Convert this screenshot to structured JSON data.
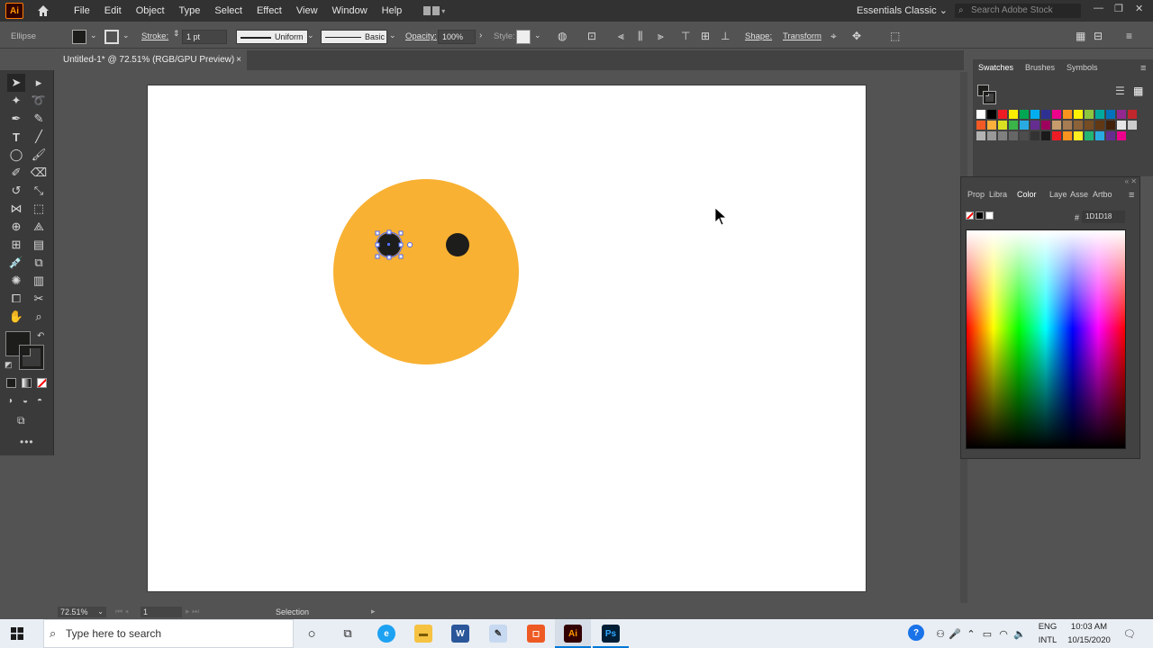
{
  "app": {
    "logo": "Ai",
    "menu": [
      "File",
      "Edit",
      "Object",
      "Type",
      "Select",
      "Effect",
      "View",
      "Window",
      "Help"
    ],
    "workspace": "Essentials Classic",
    "search_placeholder": "Search Adobe Stock"
  },
  "control_bar": {
    "selection_type": "Ellipse",
    "stroke_label": "Stroke:",
    "stroke_weight": "1 pt",
    "profile": "Uniform",
    "brush": "Basic",
    "opacity_label": "Opacity:",
    "opacity_value": "100%",
    "style_label": "Style:",
    "shape_label": "Shape:",
    "transform_label": "Transform"
  },
  "document": {
    "tab_title": "Untitled-1* @ 72.51% (RGB/GPU Preview)",
    "close": "×"
  },
  "colors": {
    "face": "#F8B133",
    "eye": "#1D1D1B",
    "fill": "#1D1D1B"
  },
  "swatches_panel": {
    "tabs": [
      "Swatches",
      "Brushes",
      "Symbols"
    ]
  },
  "color_panel": {
    "tabs": [
      "Prop",
      "Libra",
      "Color",
      "Laye",
      "Asse",
      "Artbo"
    ],
    "hash": "#",
    "hex_value": "1D1D18"
  },
  "status_bar": {
    "zoom": "72.51%",
    "artboard_num": "1",
    "tool": "Selection"
  },
  "taskbar": {
    "search_placeholder": "Type here to search",
    "lang_top": "ENG",
    "lang_bottom": "INTL",
    "time": "10:03 AM",
    "date": "10/15/2020",
    "apps": [
      {
        "name": "Ai",
        "bg": "#330000",
        "fg": "#ff9a00"
      },
      {
        "name": "Ps",
        "bg": "#001e36",
        "fg": "#31a8ff"
      }
    ]
  }
}
